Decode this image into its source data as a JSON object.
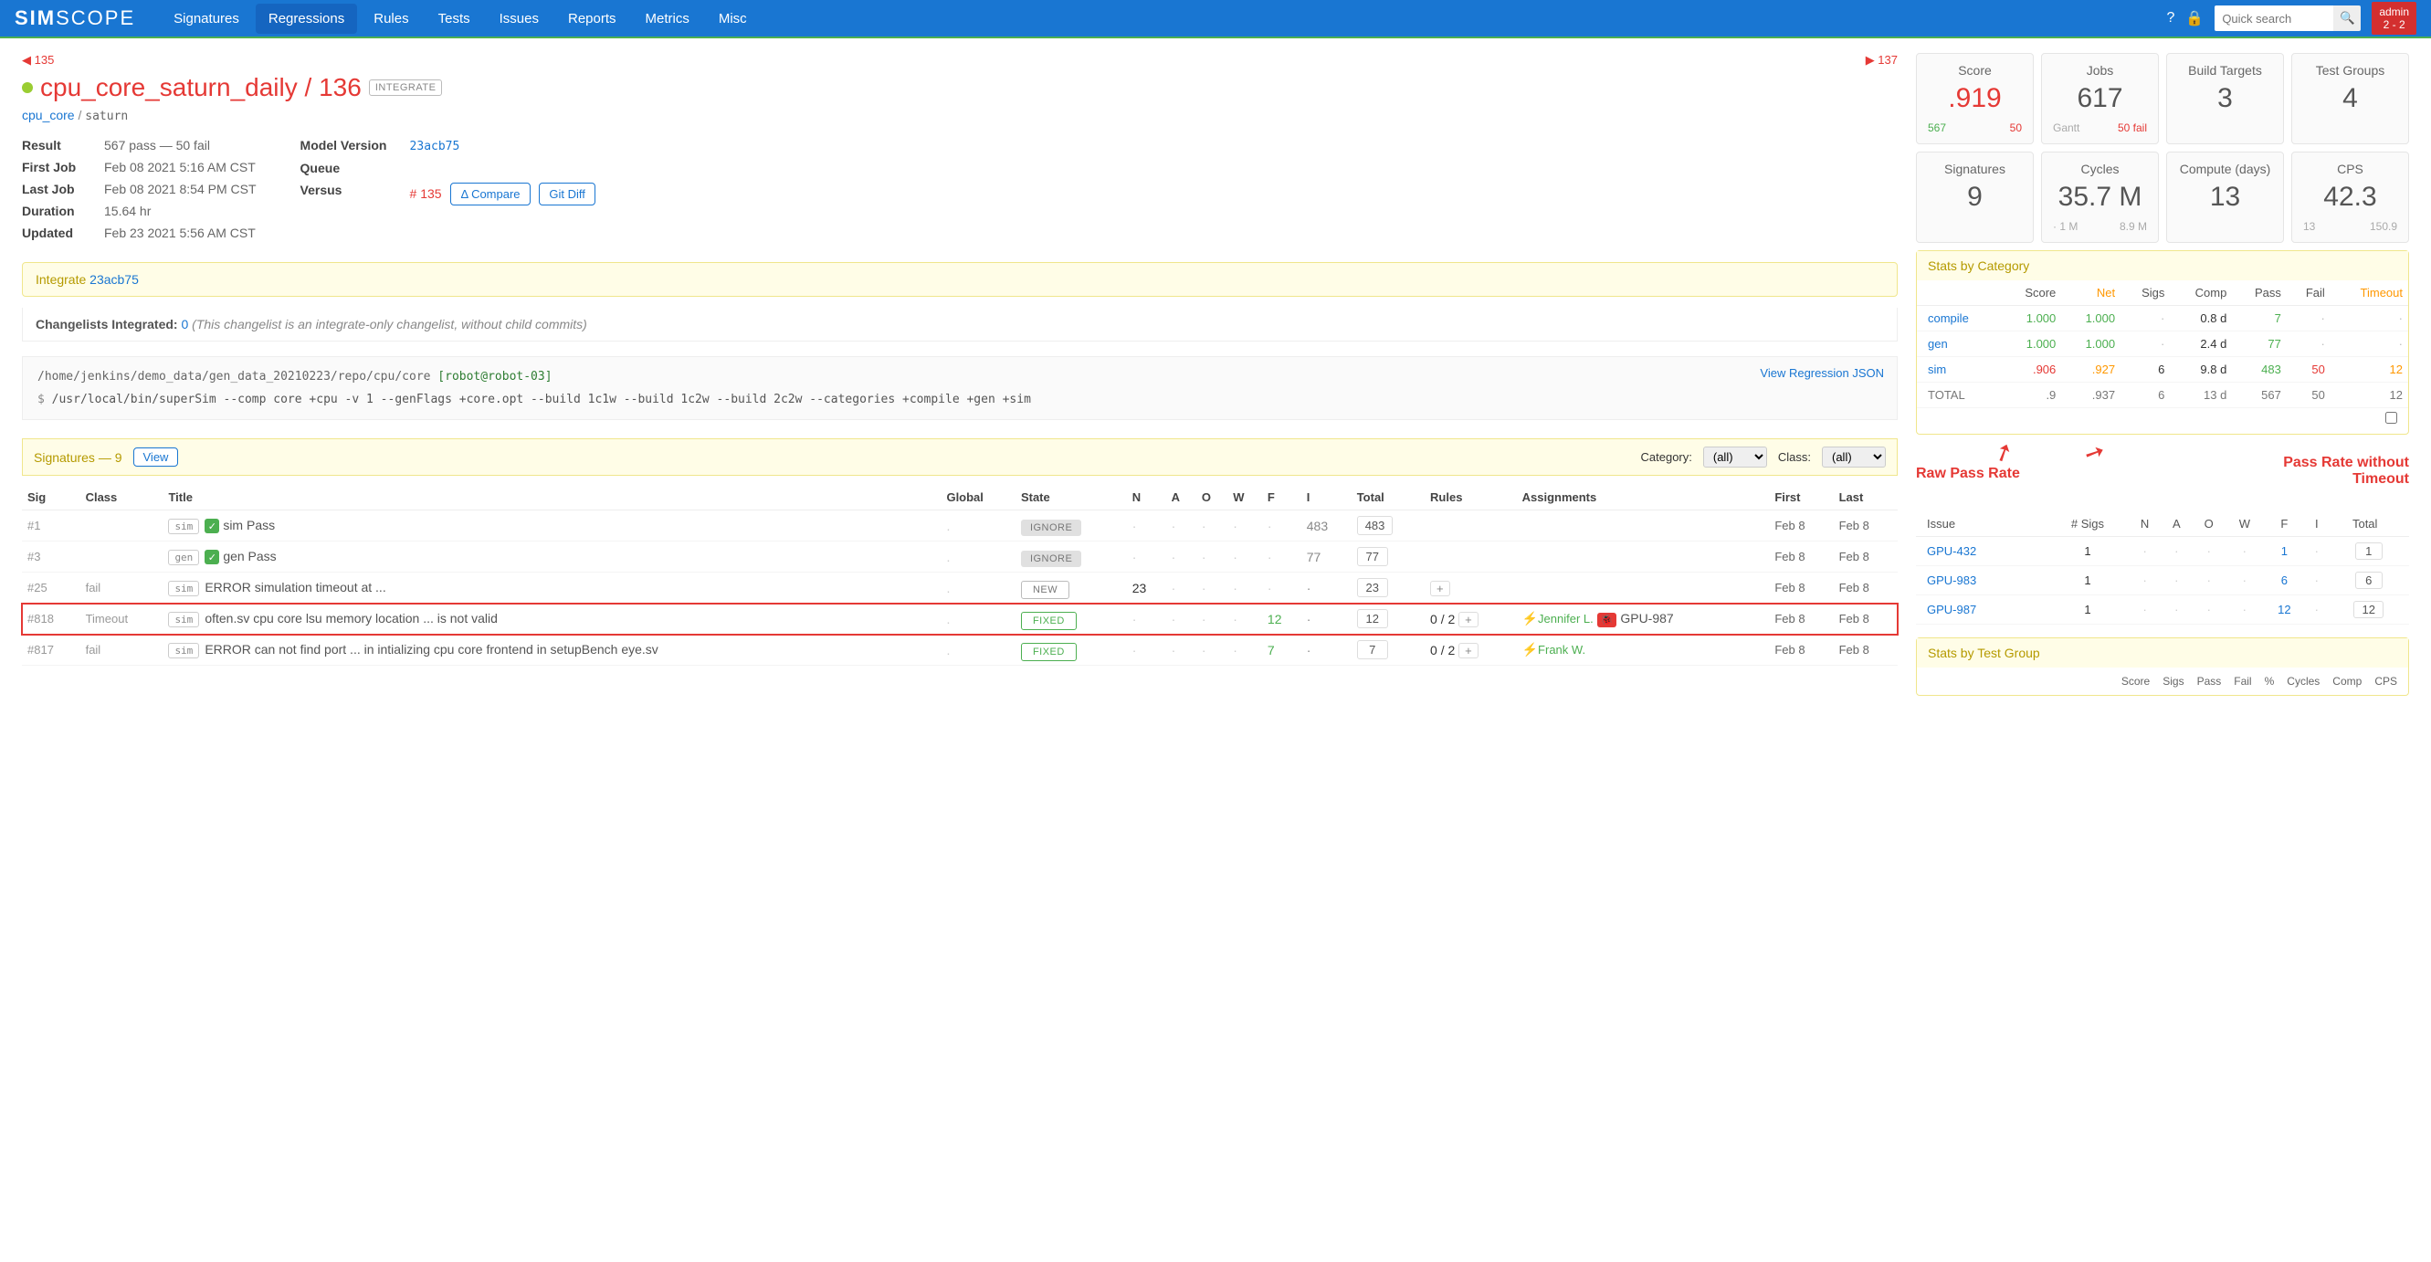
{
  "brand": {
    "sim": "SIM",
    "scope": "SCOPE"
  },
  "nav": [
    "Signatures",
    "Regressions",
    "Rules",
    "Tests",
    "Issues",
    "Reports",
    "Metrics",
    "Misc"
  ],
  "nav_active": 1,
  "search_placeholder": "Quick search",
  "admin": {
    "label": "admin",
    "sub": "2 - 2"
  },
  "prevnext": {
    "prev": "135",
    "next": "137"
  },
  "title": {
    "name": "cpu_core_saturn_daily",
    "num": "136",
    "tag": "INTEGRATE"
  },
  "breadcrumb": {
    "root": "cpu_core",
    "leaf": "saturn"
  },
  "meta_left": {
    "Result": "567 pass — 50 fail",
    "First Job": "Feb 08 2021 5:16 AM CST",
    "Last Job": "Feb 08 2021 8:54 PM CST",
    "Duration": "15.64 hr",
    "Updated": "Feb 23 2021 5:56 AM CST"
  },
  "meta_right": {
    "model_version_label": "Model Version",
    "model_version": "23acb75",
    "queue_label": "Queue",
    "versus_label": "Versus",
    "versus": "# 135",
    "compare_btn": "Δ Compare",
    "gitdiff_btn": "Git Diff"
  },
  "integrate": {
    "label": "Integrate",
    "hash": "23acb75"
  },
  "changelist": {
    "label": "Changelists Integrated:",
    "count": "0",
    "note": "(This changelist is an integrate-only changelist, without child commits)"
  },
  "codebox": {
    "path": "/home/jenkins/demo_data/gen_data_20210223/repo/cpu/core",
    "robot": "[robot@robot-03]",
    "json_link": "View Regression JSON",
    "cmd": "/usr/local/bin/superSim --comp core +cpu -v 1 --genFlags +core.opt --build 1c1w --build 1c2w --build 2c2w --categories +compile +gen +sim"
  },
  "sighdr": {
    "label": "Signatures — 9",
    "view": "View",
    "cat_label": "Category:",
    "class_label": "Class:",
    "all": "(all)"
  },
  "sigcols": [
    "Sig",
    "Class",
    "Title",
    "Global",
    "State",
    "N",
    "A",
    "O",
    "W",
    "F",
    "I",
    "Total",
    "Rules",
    "Assignments",
    "First",
    "Last"
  ],
  "sigrows": [
    {
      "id": "#1",
      "cls": "",
      "pill": "sim",
      "ok": true,
      "title": "sim Pass",
      "global": ".",
      "state": "IGNORE",
      "n": "·",
      "a": "·",
      "o": "·",
      "w": "·",
      "f": "·",
      "i": "483",
      "total": "483",
      "rules": "",
      "plus": false,
      "assign": "",
      "bug": "",
      "first": "Feb 8",
      "last": "Feb 8"
    },
    {
      "id": "#3",
      "cls": "",
      "pill": "gen",
      "ok": true,
      "title": "gen Pass",
      "global": ".",
      "state": "IGNORE",
      "n": "·",
      "a": "·",
      "o": "·",
      "w": "·",
      "f": "·",
      "i": "77",
      "total": "77",
      "rules": "",
      "plus": false,
      "assign": "",
      "bug": "",
      "first": "Feb 8",
      "last": "Feb 8"
    },
    {
      "id": "#25",
      "cls": "fail",
      "pill": "sim",
      "ok": false,
      "title": "ERROR simulation timeout at ...",
      "global": ".",
      "state": "NEW",
      "n": "23",
      "a": "·",
      "o": "·",
      "w": "·",
      "f": "·",
      "i": "·",
      "total": "23",
      "rules": "",
      "plus": true,
      "assign": "",
      "bug": "",
      "first": "Feb 8",
      "last": "Feb 8"
    },
    {
      "id": "#818",
      "cls": "Timeout",
      "pill": "sim",
      "ok": false,
      "title": "often.sv cpu core lsu memory location ... is not valid",
      "global": ".",
      "state": "FIXED",
      "n": "·",
      "a": "·",
      "o": "·",
      "w": "·",
      "f": "12",
      "i": "·",
      "total": "12",
      "rules": "0 / 2",
      "plus": true,
      "assign": "Jennifer L.",
      "bug": "GPU-987",
      "first": "Feb 8",
      "last": "Feb 8",
      "hl": true
    },
    {
      "id": "#817",
      "cls": "fail",
      "pill": "sim",
      "ok": false,
      "title": "ERROR can not find port ... in intializing cpu core frontend in setupBench eye.sv",
      "global": ".",
      "state": "FIXED",
      "n": "·",
      "a": "·",
      "o": "·",
      "w": "·",
      "f": "7",
      "i": "·",
      "total": "7",
      "rules": "0 / 2",
      "plus": true,
      "assign": "Frank W.",
      "bug": "",
      "first": "Feb 8",
      "last": "Feb 8"
    }
  ],
  "cards_top": [
    {
      "label": "Score",
      "val": ".919",
      "red": true,
      "foot_l": "567",
      "foot_l_cls": "g",
      "foot_r": "50",
      "foot_r_cls": "r"
    },
    {
      "label": "Jobs",
      "val": "617",
      "foot_l": "Gantt",
      "foot_l_cls": "muted",
      "foot_r": "50 fail",
      "foot_r_cls": "r"
    },
    {
      "label": "Build Targets",
      "val": "3"
    },
    {
      "label": "Test Groups",
      "val": "4"
    }
  ],
  "cards_bot": [
    {
      "label": "Signatures",
      "val": "9"
    },
    {
      "label": "Cycles",
      "val": "35.7 M",
      "foot_l": "1 M",
      "foot_l_cls": "muted",
      "foot_r": "8.9 M",
      "foot_r_cls": "muted",
      "foot_pre": "·"
    },
    {
      "label": "Compute (days)",
      "val": "13"
    },
    {
      "label": "CPS",
      "val": "42.3",
      "foot_l": "13",
      "foot_l_cls": "muted",
      "foot_r": "150.9",
      "foot_r_cls": "muted"
    }
  ],
  "catbox_title": "Stats by Category",
  "catcols": [
    "",
    "Score",
    "Net",
    "Sigs",
    "Comp",
    "Pass",
    "Fail",
    "Timeout"
  ],
  "catrows": [
    {
      "name": "compile",
      "score": "1.000",
      "net": "1.000",
      "sigs": "·",
      "comp": "0.8 d",
      "pass": "7",
      "fail": "·",
      "timeout": "·",
      "cls": {
        "score": "g",
        "net": "g",
        "pass": "g"
      }
    },
    {
      "name": "gen",
      "score": "1.000",
      "net": "1.000",
      "sigs": "·",
      "comp": "2.4 d",
      "pass": "77",
      "fail": "·",
      "timeout": "·",
      "cls": {
        "score": "g",
        "net": "g",
        "pass": "g"
      }
    },
    {
      "name": "sim",
      "score": ".906",
      "net": ".927",
      "sigs": "6",
      "comp": "9.8 d",
      "pass": "483",
      "fail": "50",
      "timeout": "12",
      "cls": {
        "score": "r",
        "net": "o",
        "pass": "g",
        "fail": "r",
        "timeout": "o"
      }
    }
  ],
  "cattotal": {
    "name": "TOTAL",
    "score": ".9",
    "net": ".937",
    "sigs": "6",
    "comp": "13 d",
    "pass": "567",
    "fail": "50",
    "timeout": "12"
  },
  "annotations": {
    "left": "Raw Pass Rate",
    "right": "Pass Rate without Timeout"
  },
  "isscols": [
    "Issue",
    "# Sigs",
    "N",
    "A",
    "O",
    "W",
    "F",
    "I",
    "Total"
  ],
  "issrows": [
    {
      "issue": "GPU-432",
      "sigs": "1",
      "n": "·",
      "a": "·",
      "o": "·",
      "w": "·",
      "f": "1",
      "i": "·",
      "total": "1"
    },
    {
      "issue": "GPU-983",
      "sigs": "1",
      "n": "·",
      "a": "·",
      "o": "·",
      "w": "·",
      "f": "6",
      "i": "·",
      "total": "6"
    },
    {
      "issue": "GPU-987",
      "sigs": "1",
      "n": "·",
      "a": "·",
      "o": "·",
      "w": "·",
      "f": "12",
      "i": "·",
      "total": "12"
    }
  ],
  "tgbox_title": "Stats by Test Group",
  "tgcols": [
    "Score",
    "Sigs",
    "Pass",
    "Fail",
    "%",
    "Cycles",
    "Comp",
    "CPS"
  ]
}
